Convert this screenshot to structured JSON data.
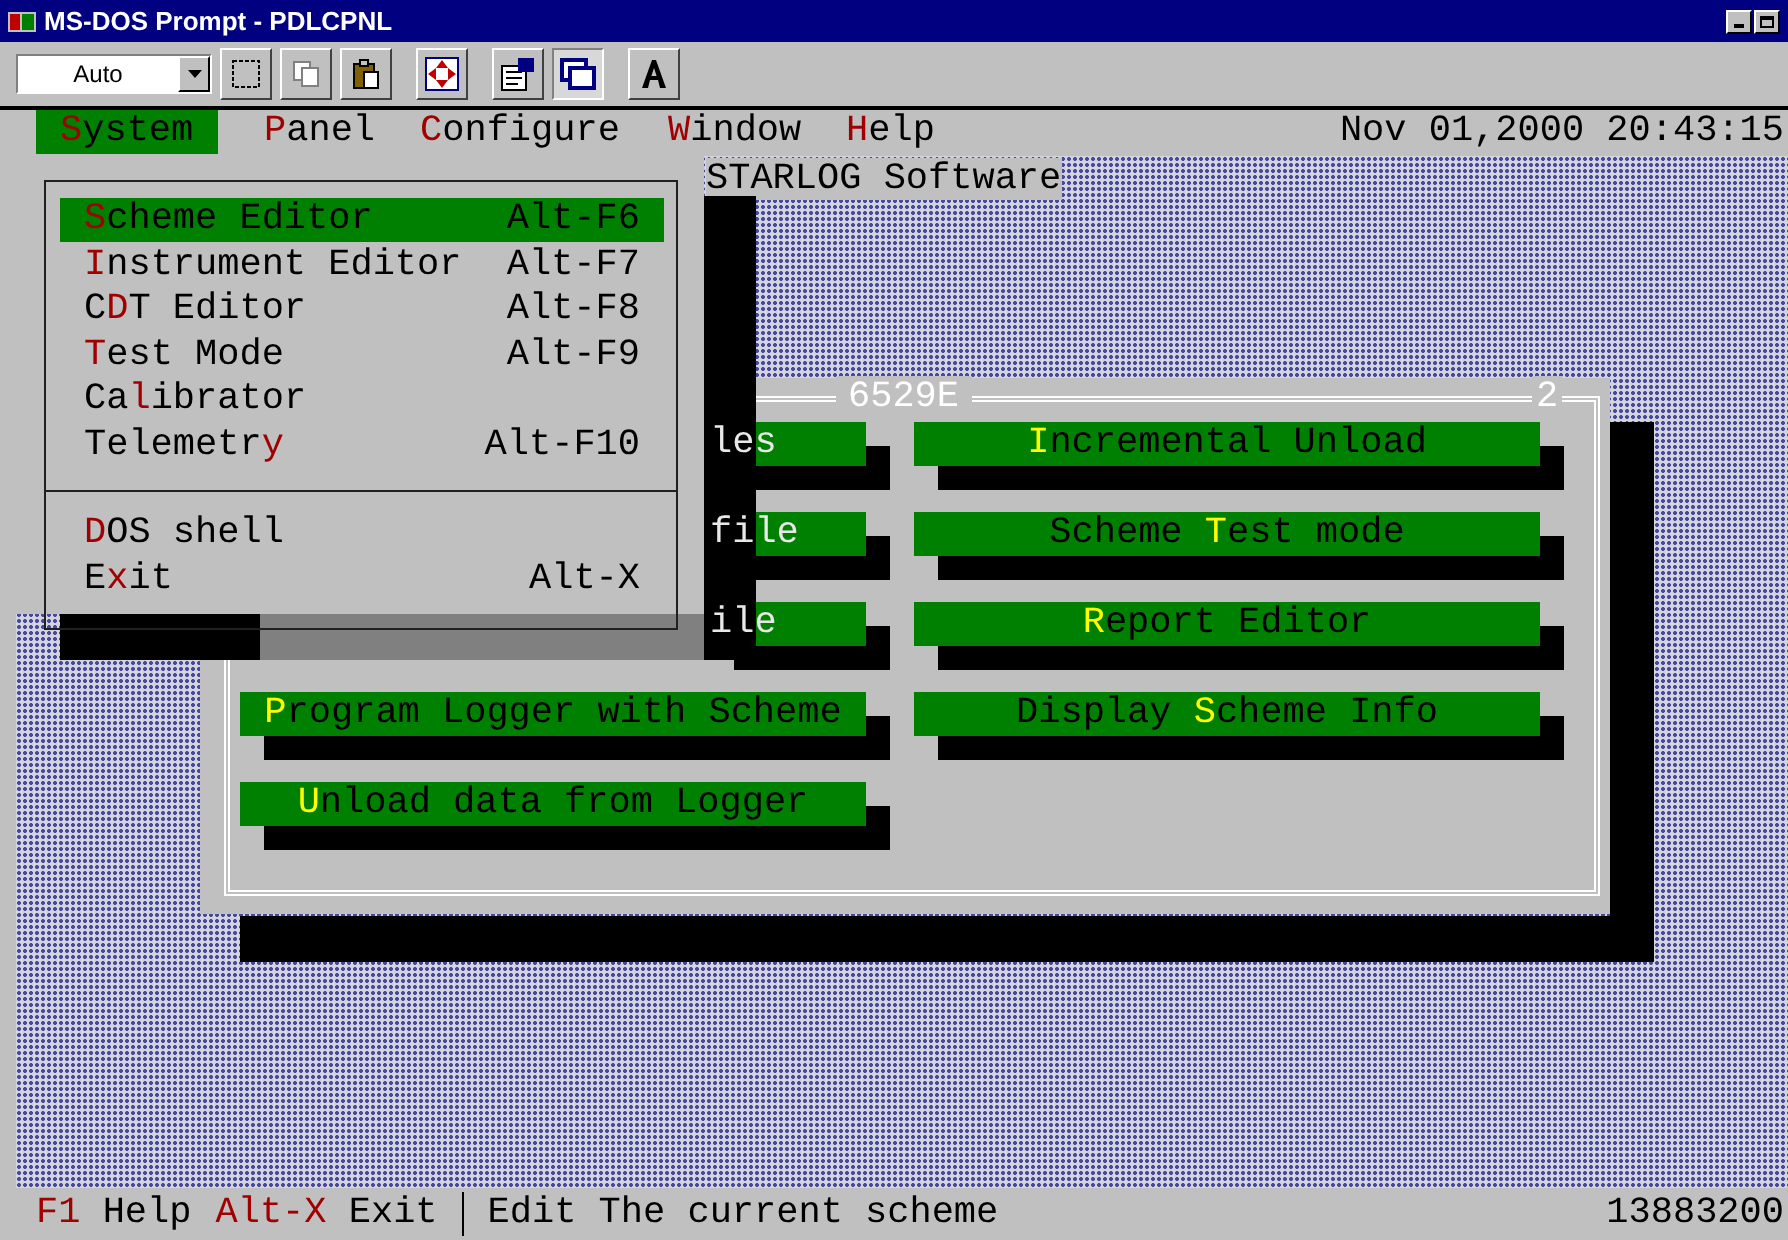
{
  "window": {
    "title": "MS-DOS Prompt - PDLCPNL"
  },
  "toolbar": {
    "font_select": {
      "value": "Auto"
    }
  },
  "menu_bar": {
    "items": [
      {
        "key": "S",
        "after": "ystem",
        "selected": true
      },
      {
        "key": "P",
        "after": "anel",
        "selected": false
      },
      {
        "key": "C",
        "after": "onfigure",
        "selected": false
      },
      {
        "key": "W",
        "after": "indow",
        "selected": false
      },
      {
        "key": "H",
        "after": "elp",
        "selected": false
      }
    ],
    "datetime": "Nov 01,2000 20:43:15"
  },
  "app_title": "STARLOG Software",
  "dropdown": {
    "groups": [
      [
        {
          "key": "S",
          "after": "cheme Editor",
          "shortcut": "Alt-F6",
          "selected": true
        },
        {
          "key": "I",
          "after": "nstrument Editor",
          "shortcut": "Alt-F7",
          "selected": false
        },
        {
          "before": "C",
          "key": "D",
          "after": "T Editor",
          "shortcut": "Alt-F8",
          "selected": false
        },
        {
          "key": "T",
          "after": "est Mode",
          "shortcut": "Alt-F9",
          "selected": false
        },
        {
          "before": "Ca",
          "key": "l",
          "after": "ibrator",
          "selected": false
        },
        {
          "before": "Telemetr",
          "key": "y",
          "shortcut": "Alt-F10",
          "selected": false
        }
      ],
      [
        {
          "key": "D",
          "after": "OS shell",
          "selected": false
        },
        {
          "before": "E",
          "key": "x",
          "after": "it",
          "shortcut": "Alt-X",
          "selected": false
        }
      ]
    ]
  },
  "dialog": {
    "title": "6529E",
    "number": "2",
    "buttons": [
      {
        "kind": "cut",
        "before": "les"
      },
      {
        "kind": "full",
        "key": "I",
        "after": "ncremental Unload"
      },
      {
        "kind": "cut",
        "before": "file"
      },
      {
        "kind": "full",
        "before": "Scheme ",
        "key": "T",
        "after": "est mode"
      },
      {
        "kind": "cut",
        "before": "ile"
      },
      {
        "kind": "full",
        "key": "R",
        "after": "eport Editor"
      },
      {
        "kind": "full",
        "key": "P",
        "after": "rogram Logger with Scheme"
      },
      {
        "kind": "full",
        "before": "Display ",
        "key": "S",
        "after": "cheme Info"
      },
      {
        "kind": "full",
        "key": "U",
        "after": "nload data from Logger"
      }
    ]
  },
  "status_bar": {
    "keys": [
      {
        "key": "F1",
        "label": "Help"
      },
      {
        "key": "Alt-X",
        "label": "Exit"
      }
    ],
    "message": "Edit The current scheme",
    "counter": "13883200"
  }
}
